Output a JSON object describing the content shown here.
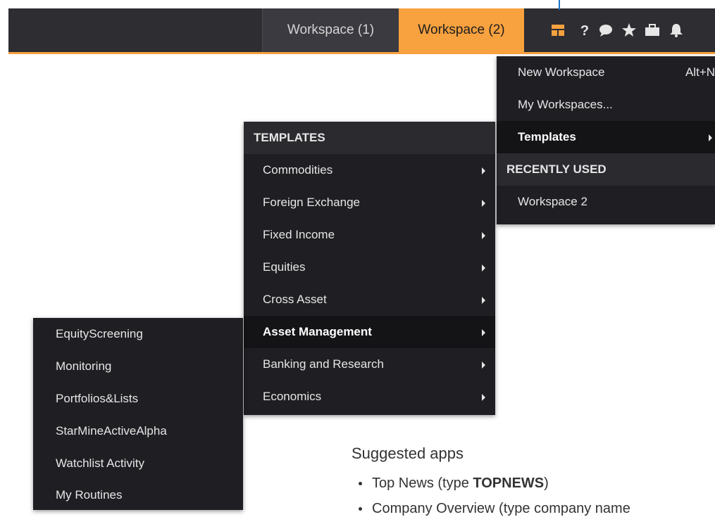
{
  "tabs": [
    {
      "label": "Workspace (1)",
      "active": false
    },
    {
      "label": "Workspace (2)",
      "active": true
    }
  ],
  "toolbar_icons": [
    "layout-icon",
    "help-icon",
    "chat-icon",
    "star-icon",
    "briefcase-icon",
    "bell-icon"
  ],
  "colors": {
    "accent": "#f7a13f",
    "bar_bg": "#2d2d32",
    "menu_bg": "#1f1f23",
    "active_item_bg": "#141417",
    "pointer": "#1a73c9"
  },
  "workspace_menu": {
    "items": [
      {
        "label": "New Workspace",
        "shortcut": "Alt+N"
      },
      {
        "label": "My Workspaces..."
      },
      {
        "label": "Templates",
        "active": true
      }
    ],
    "recent_header": "RECENTLY USED",
    "recent_items": [
      "Workspace 2"
    ]
  },
  "templates_menu": {
    "header": "TEMPLATES",
    "items": [
      {
        "label": "Commodities"
      },
      {
        "label": "Foreign Exchange"
      },
      {
        "label": "Fixed Income"
      },
      {
        "label": "Equities"
      },
      {
        "label": "Cross Asset"
      },
      {
        "label": "Asset Management",
        "active": true
      },
      {
        "label": "Banking and Research"
      },
      {
        "label": "Economics"
      }
    ]
  },
  "asset_menu": {
    "items": [
      "EquityScreening",
      "Monitoring",
      "Portfolios&Lists",
      "StarMineActiveAlpha",
      "Watchlist Activity",
      "My Routines"
    ]
  },
  "suggested": {
    "title": "Suggested apps",
    "items": [
      {
        "prefix": "Top News (type ",
        "code": "TOPNEWS",
        "suffix": ")"
      },
      {
        "prefix": "Company Overview (type company name",
        "code": "",
        "suffix": ""
      }
    ]
  }
}
